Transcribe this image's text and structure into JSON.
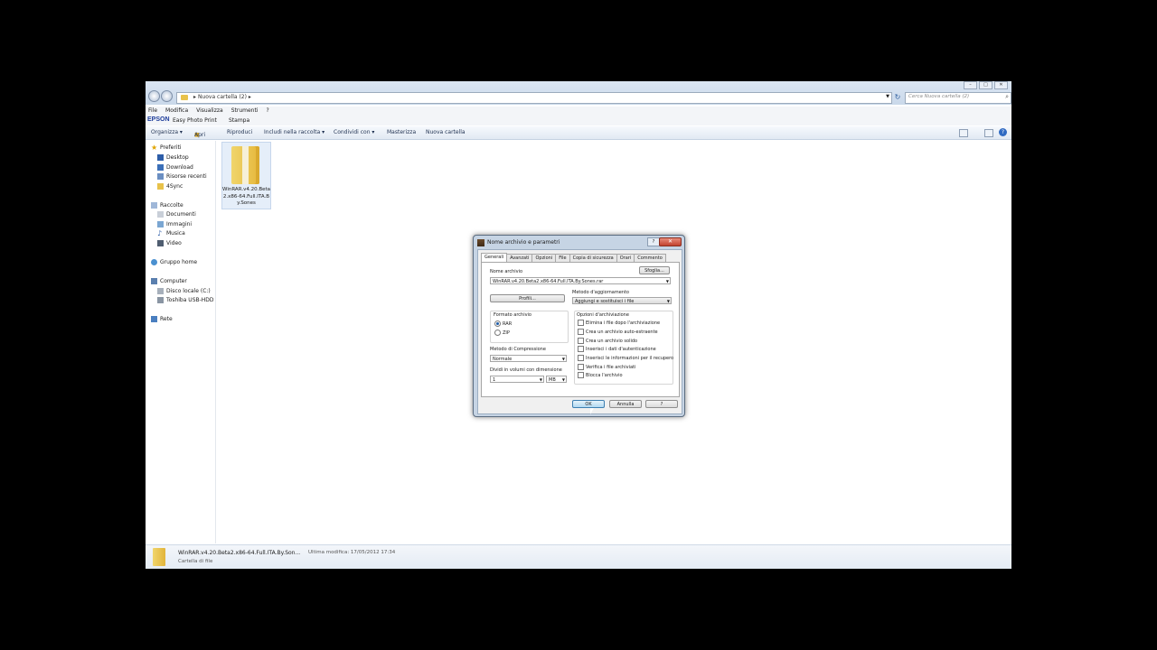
{
  "explorer": {
    "window_buttons": {
      "minimize": "–",
      "maximize": "□",
      "close": "✕"
    },
    "address": {
      "crumb": "Nuova cartella (2)",
      "separator_left": "▸",
      "separator_right": "▸"
    },
    "search_placeholder": "Cerca Nuova cartella (2)",
    "menu": [
      "File",
      "Modifica",
      "Visualizza",
      "Strumenti",
      "?"
    ],
    "epson": {
      "logo": "EPSON",
      "app": "Easy Photo Print",
      "print": "Stampa"
    },
    "toolbar": {
      "organize": "Organizza ▾",
      "open": "Apri",
      "play": "Riproduci",
      "include": "Includi nella raccolta ▾",
      "share": "Condividi con ▾",
      "burn": "Masterizza",
      "new_folder": "Nuova cartella"
    },
    "nav": {
      "favorites": "Preferiti",
      "desktop": "Desktop",
      "download": "Download",
      "recent": "Risorse recenti",
      "sync": "4Sync",
      "libraries": "Raccolte",
      "documents": "Documenti",
      "images": "Immagini",
      "music": "Musica",
      "video": "Video",
      "homegroup": "Gruppo home",
      "computer": "Computer",
      "local_disk": "Disco locale (C:)",
      "usb": "Toshiba USB-HDD (",
      "network": "Rete"
    },
    "file": {
      "label": "WinRAR.v4.20.Beta2.x86-64.Full.ITA.By.Sones"
    },
    "status": {
      "name": "WinRAR.v4.20.Beta2.x86-64.Full.ITA.By.Son...",
      "modified": "Ultima modifica: 17/05/2012 17:34",
      "type": "Cartella di file"
    }
  },
  "dialog": {
    "title": "Nome archivio e parametri",
    "help_btn": "?",
    "close_btn": "✕",
    "tabs": [
      "Generali",
      "Avanzati",
      "Opzioni",
      "File",
      "Copia di sicurezza",
      "Orari",
      "Commento"
    ],
    "archive_name_label": "Nome archivio",
    "browse": "Sfoglia...",
    "archive_name": "WinRAR.v4.20.Beta2.x86-64.Full.ITA.By.Sones.rar",
    "profiles": "Profili...",
    "update_method_label": "Metodo d'aggiornamento",
    "update_method": "Aggiungi e sostituisci i file",
    "format_label": "Formato archivio",
    "format_rar": "RAR",
    "format_zip": "ZIP",
    "compression_label": "Metodo di Compressione",
    "compression": "Normale",
    "split_label": "Dividi in volumi con dimensione",
    "split_value": "1",
    "split_unit": "MB",
    "options_label": "Opzioni d'archiviazione",
    "options": [
      "Elimina i file dopo l'archiviazione",
      "Crea un archivio auto-estraente",
      "Crea un archivio solido",
      "Inserisci i dati d'autenticazione",
      "Inserisci le informazioni per il recupero",
      "Verifica i file archiviati",
      "Blocca l'archivio"
    ],
    "ok": "OK",
    "cancel": "Annulla",
    "help": "?"
  }
}
